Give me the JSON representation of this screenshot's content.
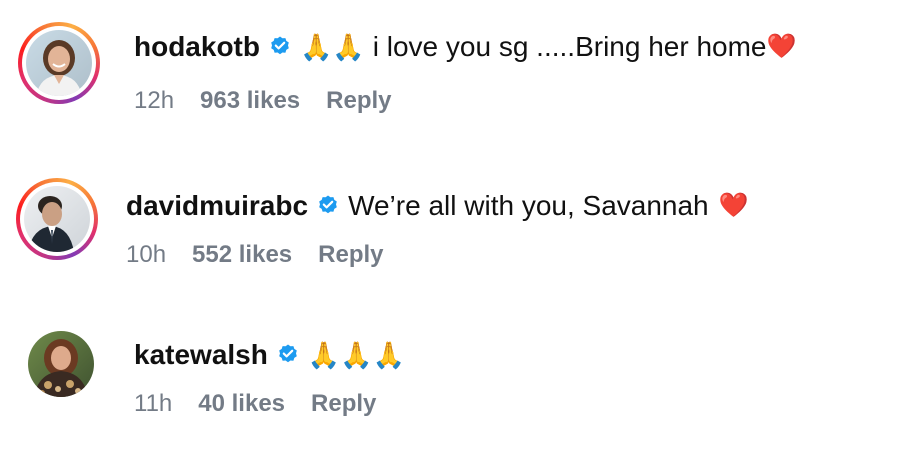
{
  "comments": [
    {
      "username": "hodakotb",
      "text": "i love you sg .....Bring her home",
      "emoji_lead": "🙏🙏",
      "emoji_trail": "❤️",
      "time": "12h",
      "likes": "963 likes",
      "reply": "Reply",
      "story_ring": true
    },
    {
      "username": "davidmuirabc",
      "text": "We’re all with you, Savannah",
      "emoji_trail": "❤️",
      "time": "10h",
      "likes": "552 likes",
      "reply": "Reply",
      "story_ring": true
    },
    {
      "username": "katewalsh",
      "emoji_lead": "🙏🙏🙏",
      "time": "11h",
      "likes": "40 likes",
      "reply": "Reply",
      "story_ring": false
    }
  ],
  "colors": {
    "verified_badge": "#1d9bf0",
    "meta_text": "#737b86",
    "heart": "#e0245e",
    "story_ring": [
      "#c13584",
      "#e1306c",
      "#fd1d1d",
      "#f77737",
      "#fcaf45"
    ]
  },
  "icons": {
    "verified": "verified-badge-icon",
    "pray": "folded-hands-emoji",
    "heart": "red-heart-emoji"
  }
}
